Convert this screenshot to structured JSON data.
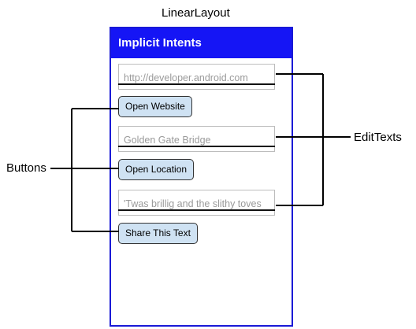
{
  "layout_label": "LinearLayout",
  "app": {
    "title": "Implicit Intents"
  },
  "edit_texts": [
    {
      "hint": "http://developer.android.com"
    },
    {
      "hint": "Golden Gate Bridge"
    },
    {
      "hint": "'Twas brillig and the slithy toves"
    }
  ],
  "buttons": [
    {
      "label": "Open Website"
    },
    {
      "label": "Open Location"
    },
    {
      "label": "Share This Text"
    }
  ],
  "callouts": {
    "buttons": "Buttons",
    "edit_texts": "EditTexts"
  },
  "colors": {
    "app_bar": "#1515f5",
    "phone_border": "#1a1ad6",
    "button_fill": "#cfe2f3"
  }
}
